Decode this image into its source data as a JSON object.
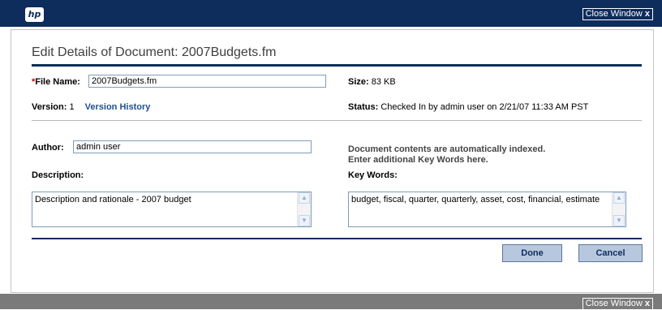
{
  "header": {
    "logo_text": "hp",
    "close_label": "Close Window",
    "close_glyph": "x"
  },
  "page": {
    "title": "Edit Details of Document: 2007Budgets.fm"
  },
  "form": {
    "file_name": {
      "required_marker": "*",
      "label": "File Name:",
      "value": "2007Budgets.fm"
    },
    "size": {
      "label": "Size:",
      "value": "83 KB"
    },
    "version": {
      "label": "Version:",
      "value": "1",
      "history_link": "Version History"
    },
    "status": {
      "label": "Status:",
      "value": "Checked In by admin user on 2/21/07 11:33 AM PST"
    },
    "author": {
      "label": "Author:",
      "value": "admin user"
    },
    "index_note": {
      "line1": "Document contents are automatically indexed.",
      "line2": "Enter additional Key Words here."
    },
    "description": {
      "label": "Description:",
      "value": "Description and rationale - 2007 budget"
    },
    "keywords": {
      "label": "Key Words:",
      "value": "budget, fiscal, quarter, quarterly, asset, cost, financial, estimate"
    }
  },
  "actions": {
    "done_label": "Done",
    "cancel_label": "Cancel"
  },
  "footer": {
    "close_label": "Close Window",
    "close_glyph": "x"
  },
  "colors": {
    "header_bg": "#0e2c5c",
    "accent_rule": "#0e2c5c",
    "link": "#1f4f8f",
    "button_bg": "#b7c7de",
    "footer_bg": "#7a7a7a",
    "required": "#cc0000"
  }
}
